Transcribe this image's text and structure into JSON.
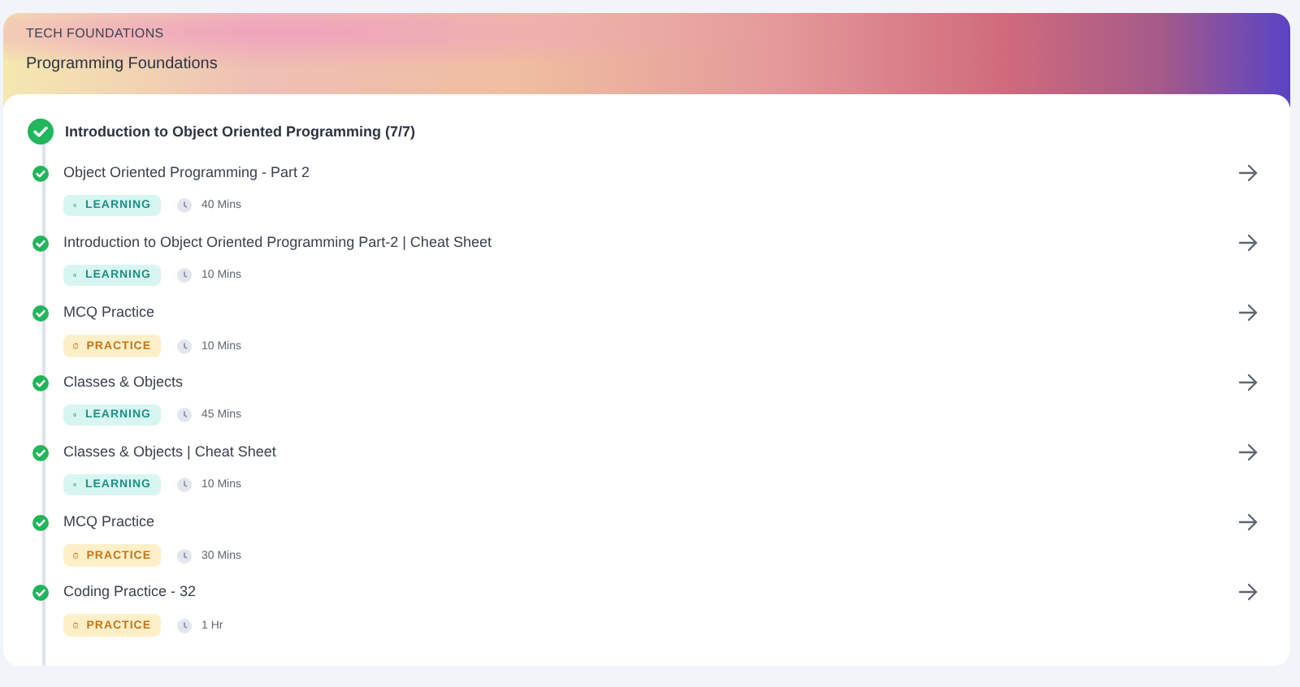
{
  "header": {
    "category": "TECH FOUNDATIONS",
    "title": "Programming Foundations"
  },
  "section": {
    "title": "Introduction to Object Oriented Programming (7/7)",
    "completed": true
  },
  "items": [
    {
      "title": "Object Oriented Programming - Part 2",
      "kind": "learning",
      "tag": "LEARNING",
      "duration": "40 Mins",
      "completed": true
    },
    {
      "title": "Introduction to Object Oriented Programming Part-2 | Cheat Sheet",
      "kind": "learning",
      "tag": "LEARNING",
      "duration": "10 Mins",
      "completed": true
    },
    {
      "title": "MCQ Practice",
      "kind": "practice",
      "tag": "PRACTICE",
      "duration": "10 Mins",
      "completed": true
    },
    {
      "title": "Classes & Objects",
      "kind": "learning",
      "tag": "LEARNING",
      "duration": "45 Mins",
      "completed": true
    },
    {
      "title": "Classes & Objects | Cheat Sheet",
      "kind": "learning",
      "tag": "LEARNING",
      "duration": "10 Mins",
      "completed": true
    },
    {
      "title": "MCQ Practice",
      "kind": "practice",
      "tag": "PRACTICE",
      "duration": "30 Mins",
      "completed": true
    },
    {
      "title": "Coding Practice - 32",
      "kind": "practice",
      "tag": "PRACTICE",
      "duration": "1 Hr",
      "completed": true
    }
  ]
}
